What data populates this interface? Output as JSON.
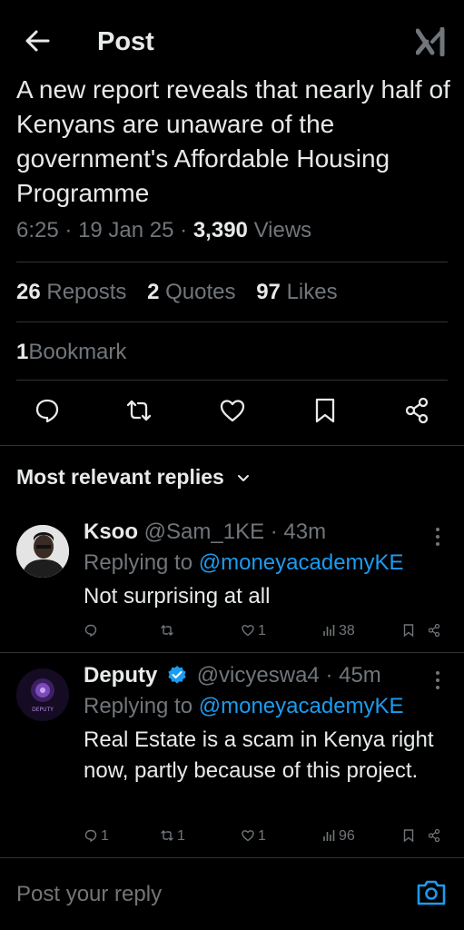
{
  "header": {
    "title": "Post"
  },
  "tweet": {
    "text": "A new report reveals that nearly half of Kenyans are unaware of the government's Affordable Housing Programme",
    "time": "6:25",
    "date": "19 Jan 25",
    "views_count": "3,390",
    "views_label": "Views",
    "reposts_count": "26",
    "reposts_label": "Reposts",
    "quotes_count": "2",
    "quotes_label": "Quotes",
    "likes_count": "97",
    "likes_label": "Likes",
    "bookmarks_count": "1",
    "bookmarks_label": "Bookmark"
  },
  "replies_header": {
    "label": "Most relevant replies"
  },
  "replies": [
    {
      "name": "Ksoo",
      "handle": "@Sam_1KE",
      "time": "· 43m",
      "replying_prefix": "Replying to",
      "replying_handle": "@moneyacademyKE",
      "body": "Not surprising at all",
      "replies": "",
      "reposts": "",
      "likes": "1",
      "views": "38"
    },
    {
      "name": "Deputy",
      "handle": "@vicyeswa4",
      "time": "· 45m",
      "replying_prefix": "Replying to",
      "replying_handle": "@moneyacademyKE",
      "body": "Real Estate is a scam in Kenya right now, partly because of this project.",
      "replies": "1",
      "reposts": "1",
      "likes": "1",
      "views": "96",
      "avatar_text": "DEPUTY"
    }
  ],
  "composer": {
    "placeholder": "Post your reply"
  },
  "colors": {
    "background": "#000000",
    "text": "#e7e9ea",
    "muted": "#71767b",
    "link": "#1d9bf0",
    "divider": "#2f3336"
  }
}
